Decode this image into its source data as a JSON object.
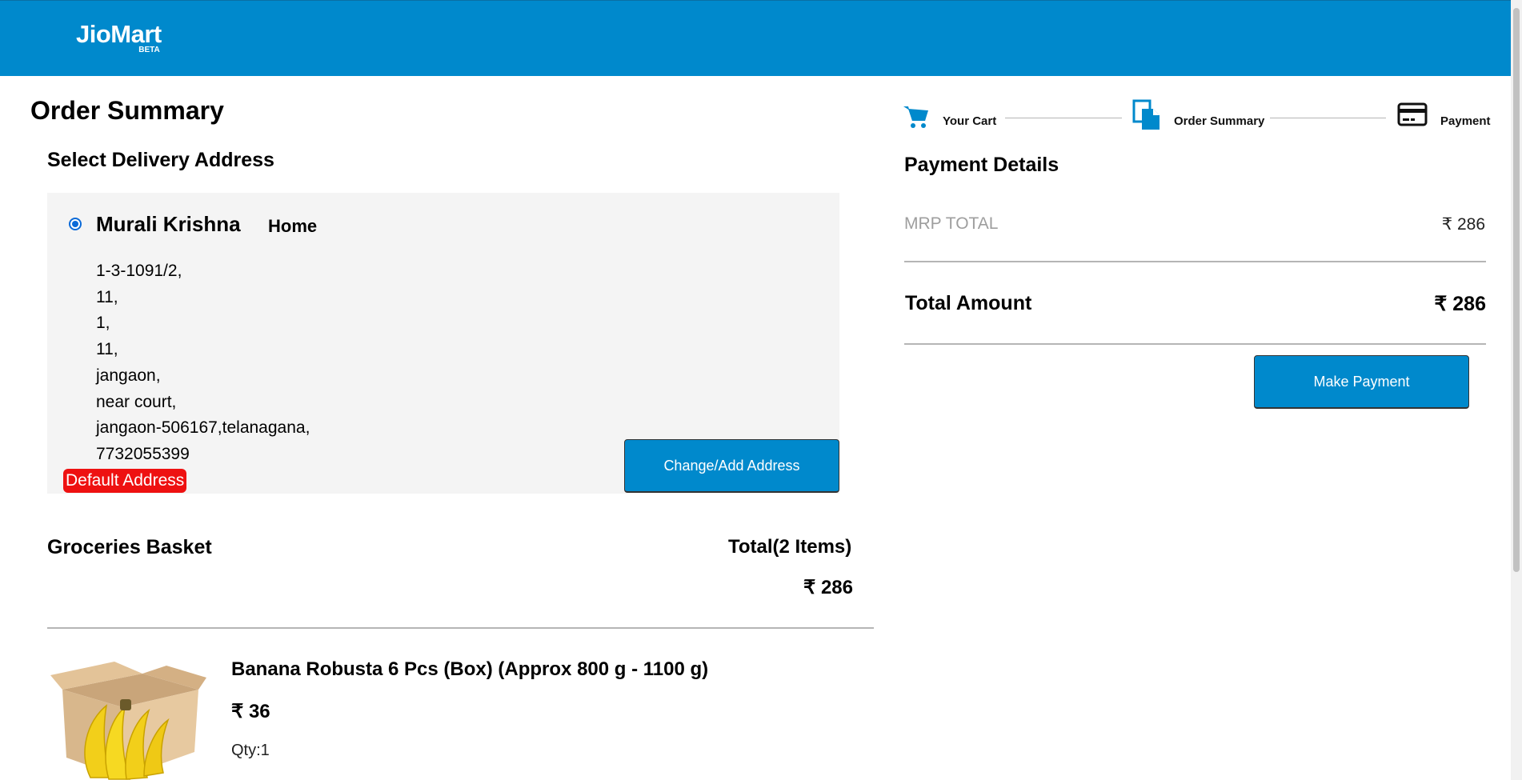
{
  "header": {
    "logo": "JioMart",
    "logo_badge": "BETA",
    "bg_color": "#0089cc"
  },
  "left": {
    "page_title": "Order Summary",
    "address_section_title": "Select Delivery Address",
    "address": {
      "name": "Murali Krishna",
      "type": "Home",
      "lines": [
        "1-3-1091/2,",
        "11,",
        "1,",
        "11,",
        "jangaon,",
        "near court,",
        "jangaon-506167,telanagana,",
        "7732055399"
      ],
      "default_badge": "Default Address",
      "selected": true
    },
    "change_address_button": "Change/Add Address",
    "basket": {
      "title": "Groceries Basket",
      "total_label": "Total(2 Items)",
      "total_value": "₹ 286"
    },
    "product": {
      "name": "Banana Robusta 6 Pcs (Box) (Approx 800 g - 1100 g)",
      "price": "₹ 36",
      "qty": "Qty:1",
      "image_icon": "banana-box-image"
    }
  },
  "right": {
    "steps": [
      {
        "label": "Your Cart",
        "icon": "cart-icon"
      },
      {
        "label": "Order Summary",
        "icon": "document-icon"
      },
      {
        "label": "Payment",
        "icon": "card-icon"
      }
    ],
    "payment_title": "Payment Details",
    "mrp_label": "MRP TOTAL",
    "mrp_value": "₹ 286",
    "total_label": "Total Amount",
    "total_value": "₹ 286",
    "pay_button": "Make Payment"
  },
  "colors": {
    "accent": "#0089cc",
    "badge": "#ee1111",
    "panel": "#f4f4f4"
  }
}
